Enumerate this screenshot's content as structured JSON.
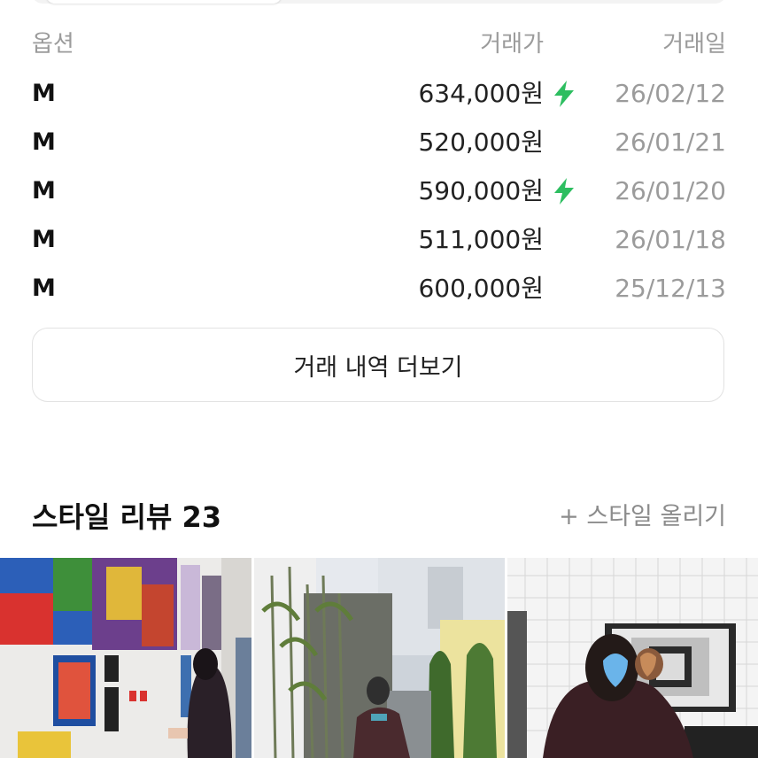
{
  "table": {
    "headers": {
      "option": "옵션",
      "price": "거래가",
      "date": "거래일"
    },
    "rows": [
      {
        "option": "M",
        "price": "634,000원",
        "fast": true,
        "date": "26/02/12"
      },
      {
        "option": "M",
        "price": "520,000원",
        "fast": false,
        "date": "26/01/21"
      },
      {
        "option": "M",
        "price": "590,000원",
        "fast": true,
        "date": "26/01/20"
      },
      {
        "option": "M",
        "price": "511,000원",
        "fast": false,
        "date": "26/01/18"
      },
      {
        "option": "M",
        "price": "600,000원",
        "fast": false,
        "date": "25/12/13"
      }
    ]
  },
  "more_button": {
    "label": "거래 내역 더보기"
  },
  "style_review": {
    "title": "스타일 리뷰 23",
    "upload_label": "+ 스타일 올리기"
  },
  "colors": {
    "bolt": "#2dbe60",
    "muted": "#9b9b9b"
  },
  "icons": {
    "fast_delivery": "lightning-bolt-icon"
  }
}
